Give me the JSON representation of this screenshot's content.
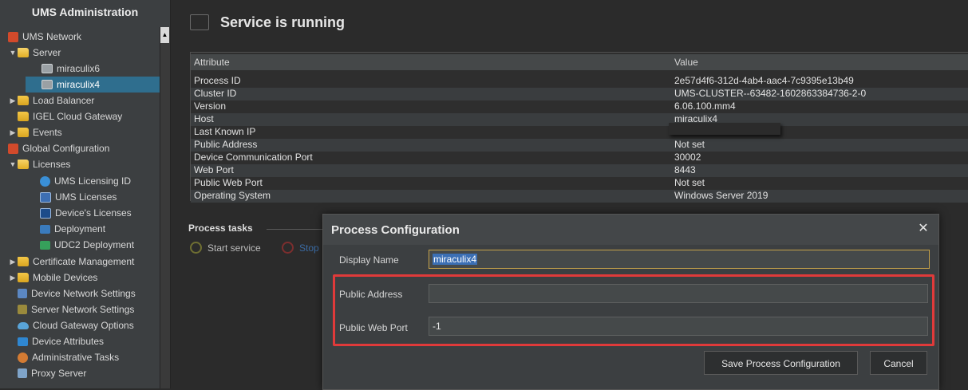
{
  "sidebar": {
    "title": "UMS Administration",
    "items": [
      {
        "label": "UMS Network",
        "icon": "ums-network-icon"
      },
      {
        "label": "Server",
        "icon": "folder-open-icon"
      },
      {
        "label": "miraculix6",
        "icon": "server-icon"
      },
      {
        "label": "miraculix4",
        "icon": "server-icon",
        "selected": true
      },
      {
        "label": "Load Balancer",
        "icon": "folder-icon"
      },
      {
        "label": "IGEL Cloud Gateway",
        "icon": "folder-icon"
      },
      {
        "label": "Events",
        "icon": "folder-icon"
      },
      {
        "label": "Global Configuration",
        "icon": "global-config-icon"
      },
      {
        "label": "Licenses",
        "icon": "folder-open-icon"
      },
      {
        "label": "UMS Licensing ID",
        "icon": "licensing-id-icon"
      },
      {
        "label": "UMS Licenses",
        "icon": "license-icon"
      },
      {
        "label": "Device's Licenses",
        "icon": "device-license-icon"
      },
      {
        "label": "Deployment",
        "icon": "deployment-icon"
      },
      {
        "label": "UDC2 Deployment",
        "icon": "udc2-icon"
      },
      {
        "label": "Certificate Management",
        "icon": "folder-icon"
      },
      {
        "label": "Mobile Devices",
        "icon": "folder-icon"
      },
      {
        "label": "Device Network Settings",
        "icon": "network-icon"
      },
      {
        "label": "Server Network Settings",
        "icon": "server-network-icon"
      },
      {
        "label": "Cloud Gateway Options",
        "icon": "cloud-icon"
      },
      {
        "label": "Device Attributes",
        "icon": "attributes-icon"
      },
      {
        "label": "Administrative Tasks",
        "icon": "admin-tasks-icon"
      },
      {
        "label": "Proxy Server",
        "icon": "proxy-icon"
      }
    ]
  },
  "header": {
    "title": "Service is running"
  },
  "table": {
    "columns": [
      "Attribute",
      "Value"
    ],
    "rows": [
      {
        "attribute": "Process ID",
        "value": "2e57d4f6-312d-4ab4-aac4-7c9395e13b49"
      },
      {
        "attribute": "Cluster ID",
        "value": "UMS-CLUSTER--63482-1602863384736-2-0"
      },
      {
        "attribute": "Version",
        "value": "6.06.100.mm4"
      },
      {
        "attribute": "Host",
        "value": "miraculix4"
      },
      {
        "attribute": "Last Known IP",
        "value": ""
      },
      {
        "attribute": "Public Address",
        "value": "Not set"
      },
      {
        "attribute": "Device Communication Port",
        "value": "30002"
      },
      {
        "attribute": "Web Port",
        "value": "8443"
      },
      {
        "attribute": "Public Web Port",
        "value": "Not set"
      },
      {
        "attribute": "Operating System",
        "value": "Windows Server 2019"
      }
    ]
  },
  "process_tasks": {
    "label": "Process tasks",
    "start_label": "Start service",
    "stop_label": "Stop"
  },
  "dialog": {
    "title": "Process Configuration",
    "close_symbol": "✕",
    "display_name_label": "Display Name",
    "display_name_value": "miraculix4",
    "public_address_label": "Public Address",
    "public_address_value": "",
    "public_web_port_label": "Public Web Port",
    "public_web_port_value": "-1",
    "save_label": "Save Process Configuration",
    "cancel_label": "Cancel"
  },
  "colors": {
    "selection": "#2f6e8e",
    "highlight": "#e03a3a",
    "input_focus": "#c5a24a"
  }
}
